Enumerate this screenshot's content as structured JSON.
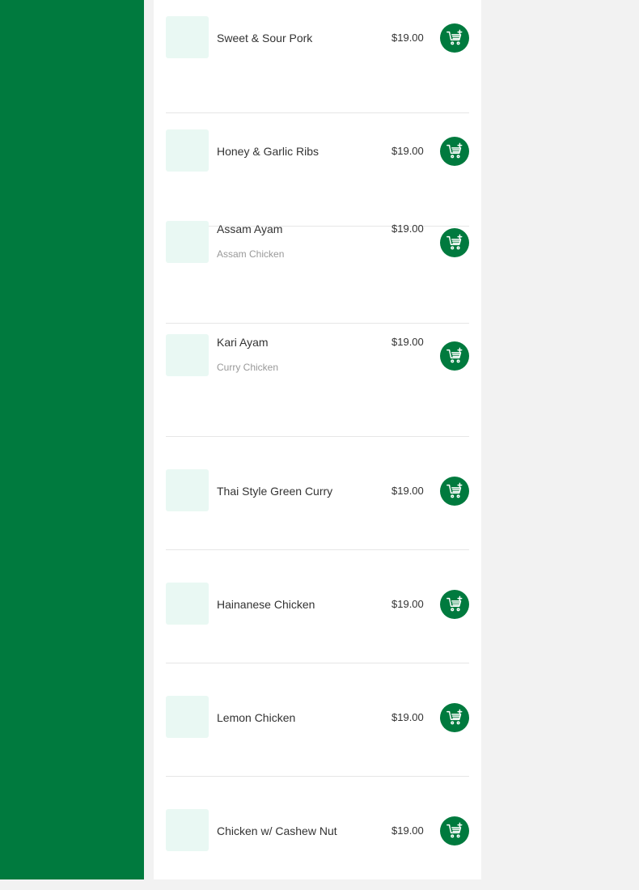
{
  "colors": {
    "brand": "#007a3e",
    "thumbnail": "#e9f8f3",
    "divider": "#e6e6e6"
  },
  "menu": {
    "items": [
      {
        "name": "Sweet & Sour Pork",
        "subtitle": "",
        "price": "$19.00"
      },
      {
        "name": "Honey & Garlic Ribs",
        "subtitle": "",
        "price": "$19.00"
      },
      {
        "name": "Assam Ayam",
        "subtitle": "Assam Chicken",
        "price": "$19.00"
      },
      {
        "name": "Kari Ayam",
        "subtitle": "Curry Chicken",
        "price": "$19.00"
      },
      {
        "name": "Thai Style Green Curry",
        "subtitle": "",
        "price": "$19.00"
      },
      {
        "name": "Hainanese Chicken",
        "subtitle": "",
        "price": "$19.00"
      },
      {
        "name": "Lemon Chicken",
        "subtitle": "",
        "price": "$19.00"
      },
      {
        "name": "Chicken w/ Cashew Nut",
        "subtitle": "",
        "price": "$19.00"
      }
    ],
    "add_icon": "add-to-cart-icon"
  }
}
